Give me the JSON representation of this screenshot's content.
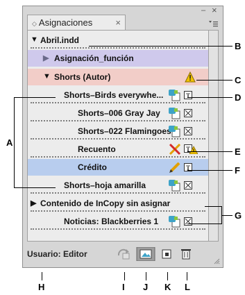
{
  "panel": {
    "tab_title": "Asignaciones",
    "minimize_glyph": "–",
    "close_glyph": "×",
    "menu_icon": "panel-menu-icon"
  },
  "rows": [
    {
      "label": "Abril.indd",
      "type": "document"
    },
    {
      "label": "Asignación_función",
      "type": "assignment"
    },
    {
      "label": "Shorts (Autor)",
      "type": "assignment-author"
    },
    {
      "label": "Shorts–Birds everywhe...",
      "type": "story"
    },
    {
      "label": "Shorts–006 Gray Jay",
      "type": "story"
    },
    {
      "label": "Shorts–022 Flamingoes",
      "type": "story"
    },
    {
      "label": "Recuento",
      "type": "story"
    },
    {
      "label": "Crédito",
      "type": "story-selected"
    },
    {
      "label": "Shorts–hoja amarilla",
      "type": "story"
    },
    {
      "label": "Contenido de InCopy sin asignar",
      "type": "group"
    },
    {
      "label": "Noticias: Blackberries 1",
      "type": "story"
    }
  ],
  "footer": {
    "user_label": "Usuario: Editor"
  },
  "callouts": [
    "A",
    "B",
    "C",
    "D",
    "E",
    "F",
    "G",
    "H",
    "I",
    "J",
    "K",
    "L"
  ],
  "colors": {
    "assignment_bg": "#cfc9ec",
    "author_bg": "#f2cdc8",
    "selected_bg": "#b8cdee",
    "warning": "#f2c200"
  }
}
